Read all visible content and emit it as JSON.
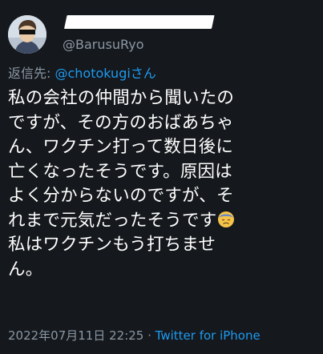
{
  "author": {
    "display_name": "",
    "handle": "@BarusuRyo"
  },
  "reply": {
    "prefix": "返信先: ",
    "mention": "@chotokugiさん"
  },
  "tweet": {
    "lines": [
      "私の会社の仲間から聞いたの",
      "ですが、その方のおばあちゃ",
      "ん、ワクチン打って数日後に",
      "亡くなったそうです。原因は",
      "よく分からないのですが、そ",
      "れまで元気だったそうです",
      "私はワクチンもう打ちませ",
      "ん。"
    ],
    "emoji": "disappointed-face-emoji"
  },
  "meta": {
    "datetime": "2022年07月11日 22:25",
    "separator": " · ",
    "source": "Twitter for iPhone"
  },
  "colors": {
    "background": "#15181c",
    "text": "#ffffff",
    "secondary": "#8b98a5",
    "link": "#1d9bf0"
  }
}
